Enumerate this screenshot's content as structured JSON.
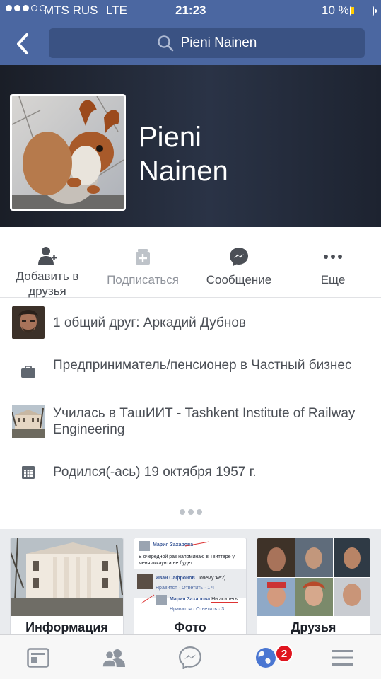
{
  "status_bar": {
    "carrier": "MTS RUS",
    "network": "LTE",
    "time": "21:23",
    "battery": "10 %"
  },
  "nav": {
    "back_icon": "chevron-left-icon",
    "search_text": "Pieni Nainen"
  },
  "profile": {
    "name_line1": "Pieni",
    "name_line2": "Nainen"
  },
  "actions": [
    {
      "label": "Добавить в друзья",
      "icon": "add-friend-icon"
    },
    {
      "label": "Подписаться",
      "icon": "follow-icon"
    },
    {
      "label": "Сообщение",
      "icon": "messenger-icon"
    },
    {
      "label": "Еще",
      "icon": "more-icon"
    }
  ],
  "details": {
    "mutual": "1 общий друг: Аркадий Дубнов",
    "work": "Предприниматель/пенсионер в Частный бизнес",
    "education": "Училась в ТашИИТ - Tashkent Institute of Railway Engineering",
    "birthday": "Родился(-ась) 19 октября 1957 г."
  },
  "cards": {
    "info": "Информация",
    "photo": "Фото",
    "friends": "Друзья",
    "photo_preview": {
      "name1": "Мария Захарова",
      "line1": "В очередной раз напоминаю в Твиттере у меня аккаунта не будет.",
      "name2": "Иван Сафронов",
      "q": "Почему же?)",
      "like": "Нравится",
      "reply": "Ответить",
      "ago": "1 ч",
      "name3": "Мария Захарова",
      "line3": "Ни асилеть",
      "count": "3"
    }
  },
  "tabbar": {
    "notifications_badge": "2"
  },
  "colors": {
    "brand": "#4b67a1",
    "search_bg": "#3a5283",
    "badge": "#e0151f"
  }
}
